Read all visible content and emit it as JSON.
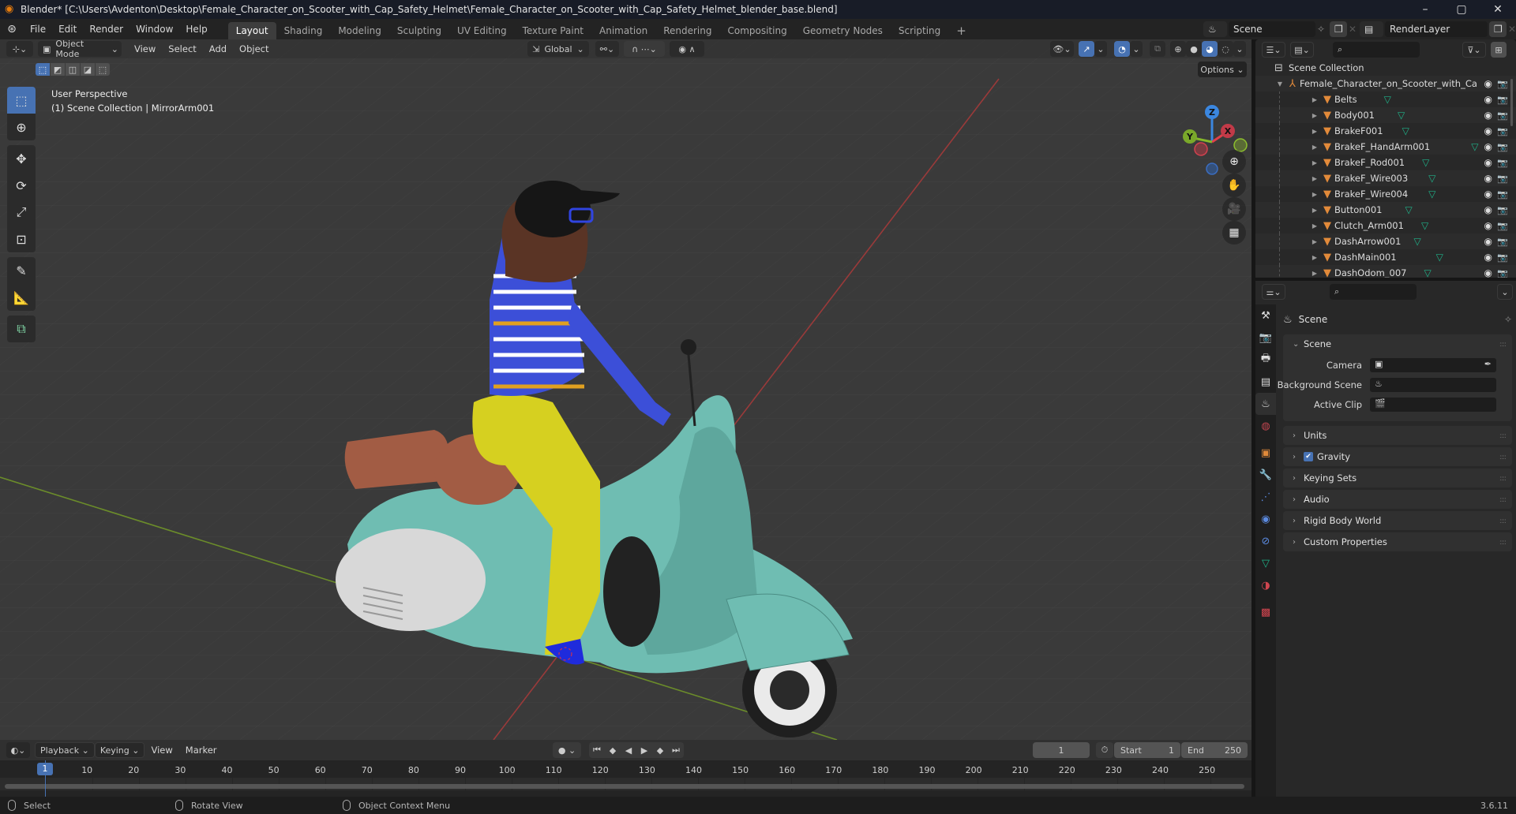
{
  "window": {
    "title": "Blender* [C:\\Users\\Avdenton\\Desktop\\Female_Character_on_Scooter_with_Cap_Safety_Helmet\\Female_Character_on_Scooter_with_Cap_Safety_Helmet_blender_base.blend]",
    "controls": {
      "minimize": "–",
      "maximize": "▢",
      "close": "✕"
    }
  },
  "menu": [
    "File",
    "Edit",
    "Render",
    "Window",
    "Help"
  ],
  "workspaces": [
    {
      "label": "Layout",
      "active": true
    },
    {
      "label": "Shading"
    },
    {
      "label": "Modeling"
    },
    {
      "label": "Sculpting"
    },
    {
      "label": "UV Editing"
    },
    {
      "label": "Texture Paint"
    },
    {
      "label": "Animation"
    },
    {
      "label": "Rendering"
    },
    {
      "label": "Compositing"
    },
    {
      "label": "Geometry Nodes"
    },
    {
      "label": "Scripting"
    }
  ],
  "add_workspace": "+",
  "scene_selector": {
    "value": "Scene"
  },
  "view_layer_selector": {
    "value": "RenderLayer"
  },
  "viewport": {
    "mode": "Object Mode",
    "menus": [
      "View",
      "Select",
      "Add",
      "Object"
    ],
    "transform_orientation": "Global",
    "options_label": "Options",
    "overlay_line1": "User Perspective",
    "overlay_line2": "(1) Scene Collection | MirrorArm001",
    "gizmo_axes": {
      "z": "Z",
      "x": "X",
      "y": "Y"
    },
    "shading_active": "material-preview",
    "accent_color": "#4772b3"
  },
  "outliner": {
    "root": "Scene Collection",
    "collection": "Female_Character_on_Scooter_with_Ca",
    "objects": [
      "Belts",
      "Body001",
      "BrakeF001",
      "BrakeF_HandArm001",
      "BrakeF_Rod001",
      "BrakeF_Wire003",
      "BrakeF_Wire004",
      "Button001",
      "Clutch_Arm001",
      "DashArrow001",
      "DashMain001",
      "DashOdom_007"
    ]
  },
  "properties": {
    "context_title": "Scene",
    "scene_panel": {
      "title": "Scene",
      "fields": [
        {
          "label": "Camera",
          "value": ""
        },
        {
          "label": "Background Scene",
          "value": ""
        },
        {
          "label": "Active Clip",
          "value": ""
        }
      ]
    },
    "panels": [
      {
        "title": "Units"
      },
      {
        "title": "Gravity",
        "checkbox": true
      },
      {
        "title": "Keying Sets"
      },
      {
        "title": "Audio"
      },
      {
        "title": "Rigid Body World"
      },
      {
        "title": "Custom Properties"
      }
    ]
  },
  "timeline": {
    "menus": [
      "Playback",
      "Keying",
      "View",
      "Marker"
    ],
    "current_frame": "1",
    "start_label": "Start",
    "start": "1",
    "end_label": "End",
    "end": "250",
    "ticks": [
      "10",
      "20",
      "30",
      "40",
      "50",
      "60",
      "70",
      "80",
      "90",
      "100",
      "110",
      "120",
      "130",
      "140",
      "150",
      "160",
      "170",
      "180",
      "190",
      "200",
      "210",
      "220",
      "230",
      "240",
      "250"
    ],
    "playhead": "1"
  },
  "statusbar": {
    "left": "Select",
    "middle": "Rotate View",
    "right": "Object Context Menu",
    "version": "3.6.11"
  }
}
